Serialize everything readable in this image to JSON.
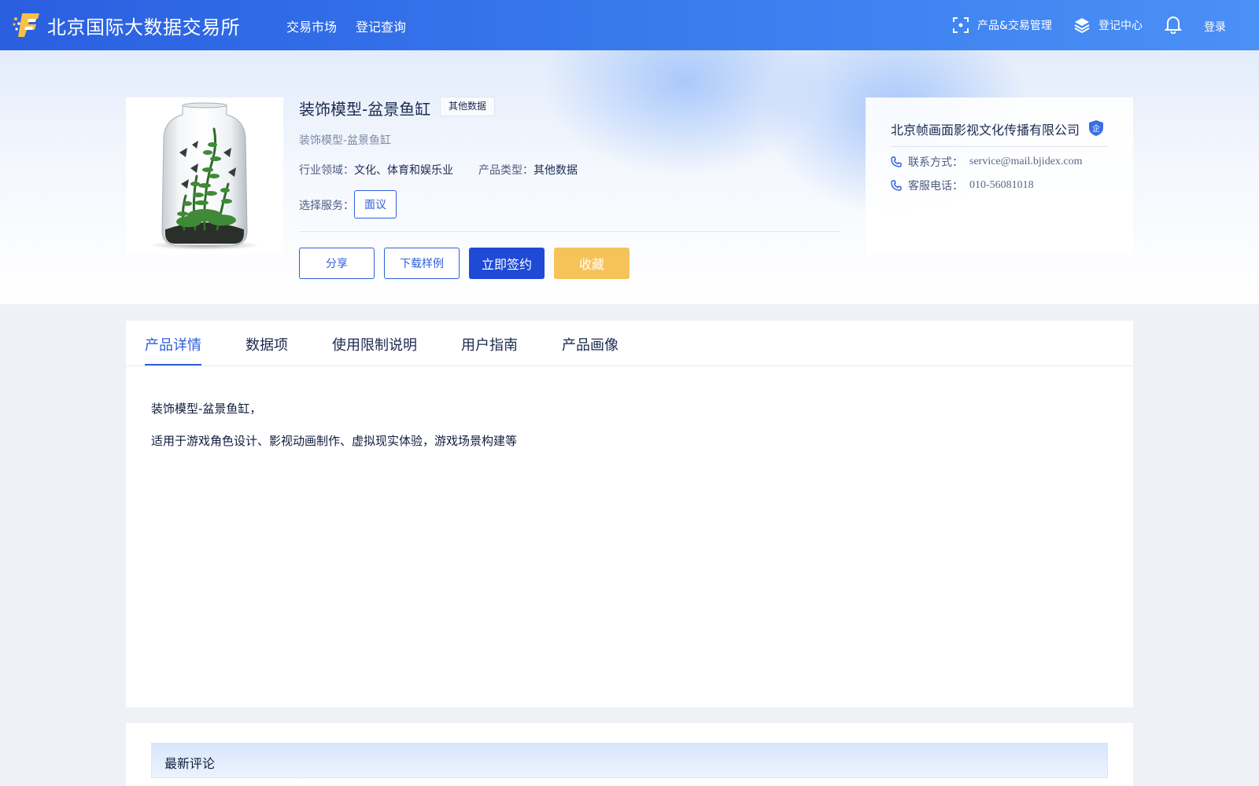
{
  "header": {
    "logo_text": "北京国际大数据交易所",
    "nav": {
      "market": "交易市场",
      "query": "登记查询"
    },
    "product_trade_mgmt": "产品&交易管理",
    "registration_center": "登记中心",
    "login": "登录",
    "icons": [
      "scan-icon",
      "layers-icon",
      "bell-icon"
    ]
  },
  "product": {
    "title": "装饰模型-盆景鱼缸",
    "badge": "其他数据",
    "subtitle": "装饰模型-盆景鱼缸",
    "industry_label": "行业领域：",
    "industry_value": "文化、体育和娱乐业",
    "type_label": "产品类型：",
    "type_value": "其他数据",
    "service_label": "选择服务：",
    "service_option": "面议",
    "image_desc": "aquarium-bottle-image"
  },
  "actions": {
    "share": "分享",
    "download": "下载样例",
    "sign": "立即签约",
    "favorite": "收藏"
  },
  "company": {
    "name": "北京帧画面影视文化传播有限公司",
    "verified_badge": "企",
    "contact_label": "联系方式：",
    "contact_value": "service@mail.bjidex.com",
    "phone_label": "客服电话：",
    "phone_value": "010-56081018"
  },
  "tabs": [
    {
      "label": "产品详情",
      "active": true
    },
    {
      "label": "数据项",
      "active": false
    },
    {
      "label": "使用限制说明",
      "active": false
    },
    {
      "label": "用户指南",
      "active": false
    },
    {
      "label": "产品画像",
      "active": false
    }
  ],
  "details": {
    "line1": "装饰模型-盆景鱼缸，",
    "line2": "适用于游戏角色设计、影视动画制作、虚拟现实体验，游戏场景构建等"
  },
  "comments": {
    "title": "最新评论"
  },
  "colors": {
    "primary": "#1e4ad6",
    "accent_blue": "#2f5fd8",
    "favorite_yellow": "#f6c35a",
    "header_gradient_start": "#2a5fe0",
    "header_gradient_end": "#4b90f5"
  }
}
